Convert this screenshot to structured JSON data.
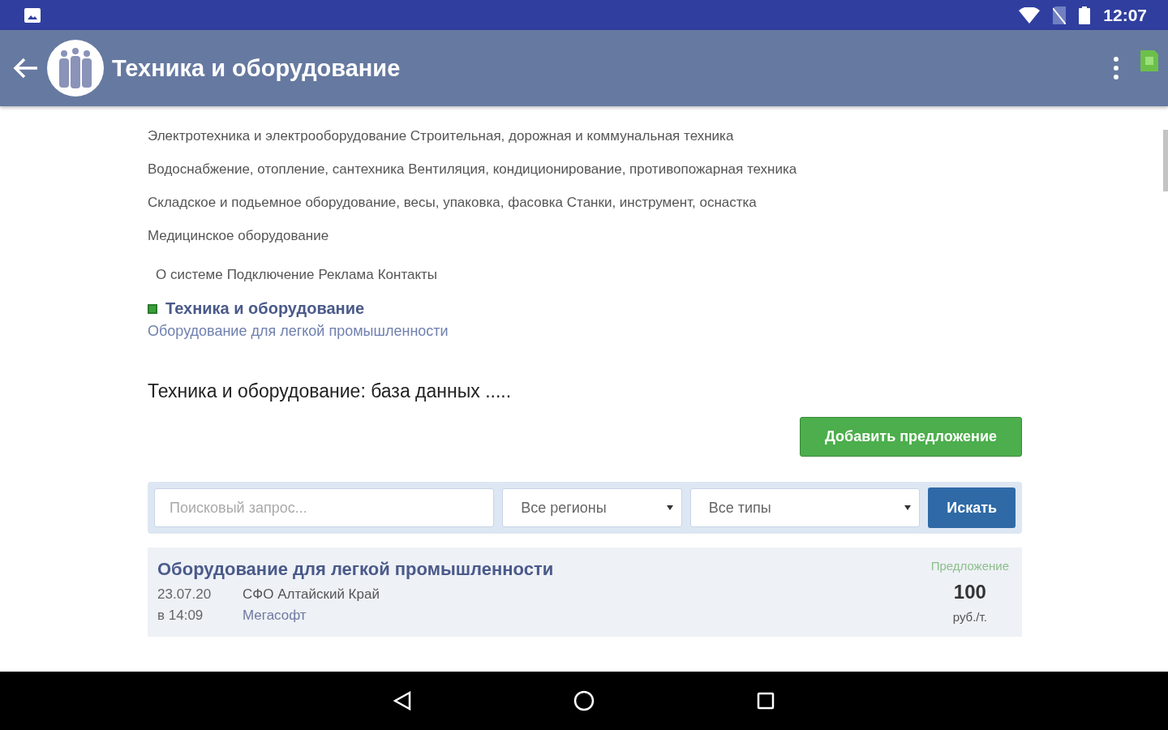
{
  "status_bar": {
    "time": "12:07"
  },
  "app_bar": {
    "title": "Техника и оборудование"
  },
  "categories": [
    "Электротехника и электрооборудование Строительная, дорожная и коммунальная техника",
    "Водоснабжение, отопление, сантехника Вентиляция, кондиционирование, противопожарная техника",
    "Складское и подьемное оборудование, весы, упаковка, фасовка Станки, инструмент, оснастка",
    "Медицинское оборудование"
  ],
  "footer_links": [
    "О системе",
    "Подключение",
    "Реклама",
    "Контакты"
  ],
  "breadcrumb": {
    "section": "Техника и оборудование",
    "subsection": "Оборудование для легкой промышленности"
  },
  "heading": "Техника и оборудование: база данных .....",
  "add_button": "Добавить предложение",
  "search": {
    "placeholder": "Поисковый запрос...",
    "region": "Все регионы",
    "type": "Все типы",
    "button": "Искать"
  },
  "listings": [
    {
      "title": "Оборудование для легкой промышленности",
      "date": "23.07.20",
      "time": "в 14:09",
      "region": "СФО Алтайский Край",
      "company": "Мегасофт",
      "kind": "Предложение",
      "price": "100",
      "unit": "руб./т."
    }
  ]
}
